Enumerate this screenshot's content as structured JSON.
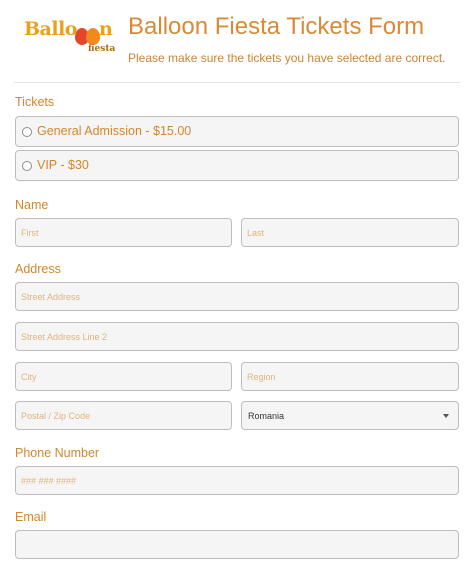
{
  "logo": {
    "word": "Ballo",
    "word_end": "n",
    "sub": "fiesta"
  },
  "header": {
    "title": "Balloon Fiesta Tickets Form",
    "subtitle": "Please make sure the tickets you have selected are correct."
  },
  "tickets": {
    "label": "Tickets",
    "options": [
      {
        "label": "General Admission - $15.00",
        "selected": false
      },
      {
        "label": "VIP - $30",
        "selected": false
      }
    ]
  },
  "name": {
    "label": "Name",
    "first_placeholder": "First",
    "last_placeholder": "Last"
  },
  "address": {
    "label": "Address",
    "street_placeholder": "Street Address",
    "street2_placeholder": "Street Address Line 2",
    "city_placeholder": "City",
    "region_placeholder": "Region",
    "postal_placeholder": "Postal / Zip Code",
    "country_value": "Romania"
  },
  "phone": {
    "label": "Phone Number",
    "placeholder": "### ### ####"
  },
  "email": {
    "label": "Email",
    "placeholder": ""
  },
  "colors": {
    "accent": "#d4862a",
    "field_bg": "#f5f5f5",
    "field_border": "#bdbdbd"
  }
}
